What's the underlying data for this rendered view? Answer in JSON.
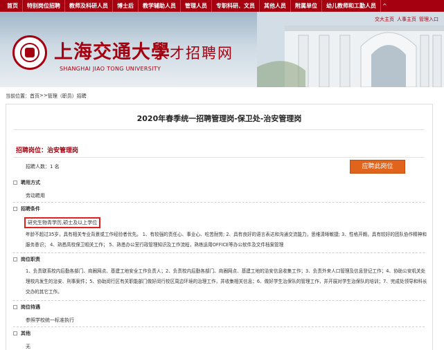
{
  "nav": {
    "items": [
      "首页",
      "特别岗位招聘",
      "教师及科研人员",
      "博士后",
      "教学辅助人员",
      "管理人员",
      "专职科研、文员",
      "其他人员",
      "附属单位",
      "幼儿教师和工勤人员"
    ],
    "caret": "^"
  },
  "banner": {
    "logo_cn": "上海交通大學",
    "logo_en": "SHANGHAI JIAO TONG UNIVERSITY",
    "logo_sub": "人才招聘网",
    "links": [
      "交大主页",
      "人事主页",
      "管理入口"
    ]
  },
  "breadcrumb": {
    "label": "当前位置：",
    "home": "首页",
    "sep": ">>",
    "current": "管理（职员）招聘"
  },
  "post": {
    "title": "2020年春季统一招聘管理岗-保卫处-治安管理岗",
    "position_label": "招聘岗位：治安管理岗",
    "headcount": "招聘人数：1 名",
    "apply_button": "应聘此岗位",
    "sections": {
      "employment_type": {
        "heading": "聘用方式",
        "value": "劳动聘用"
      },
      "requirements": {
        "heading": "招聘条件",
        "highlight": "研究生物青学历,硕士及以上学位",
        "text": "年龄不超过35岁，具有相关专业背景或工作经验者优先。 1、有较强的责任心、事业心、吃苦耐劳; 2、具有良好的语言表达和沟通交流能力，思维清晰敏捷; 3、性格开朗，具有较好的团队协作精神和服务意识； 4、熟悉高校保卫相关工作； 5、熟悉办公室行政管理知识及工作流程，熟练运用OFFICE等办公软件及文件档案管理"
      },
      "duties": {
        "heading": "岗位职责",
        "text": "1、负责联系校内后勤各部门、商圈网点、基建工地安全工作负责人；2、负责校内后勤各部门、商圈网点、基建工地的治安信息收集工作；3、负责外来人口管理及信息登记工作；4、协助公安机关处理校内发生的治安、刑事案件；5、协助闵行区有关职能部门做好闵行校区周边环境的治理工作，并收集相关信息；6、做好学生治保队的管理工作，并开展对学生治保队的培训；7、完成处领导和科长交办的其它工作。"
      },
      "benefits": {
        "heading": "岗位待遇",
        "value": "参照学校统一标准执行"
      },
      "other": {
        "heading": "其他",
        "value": "无"
      }
    }
  }
}
